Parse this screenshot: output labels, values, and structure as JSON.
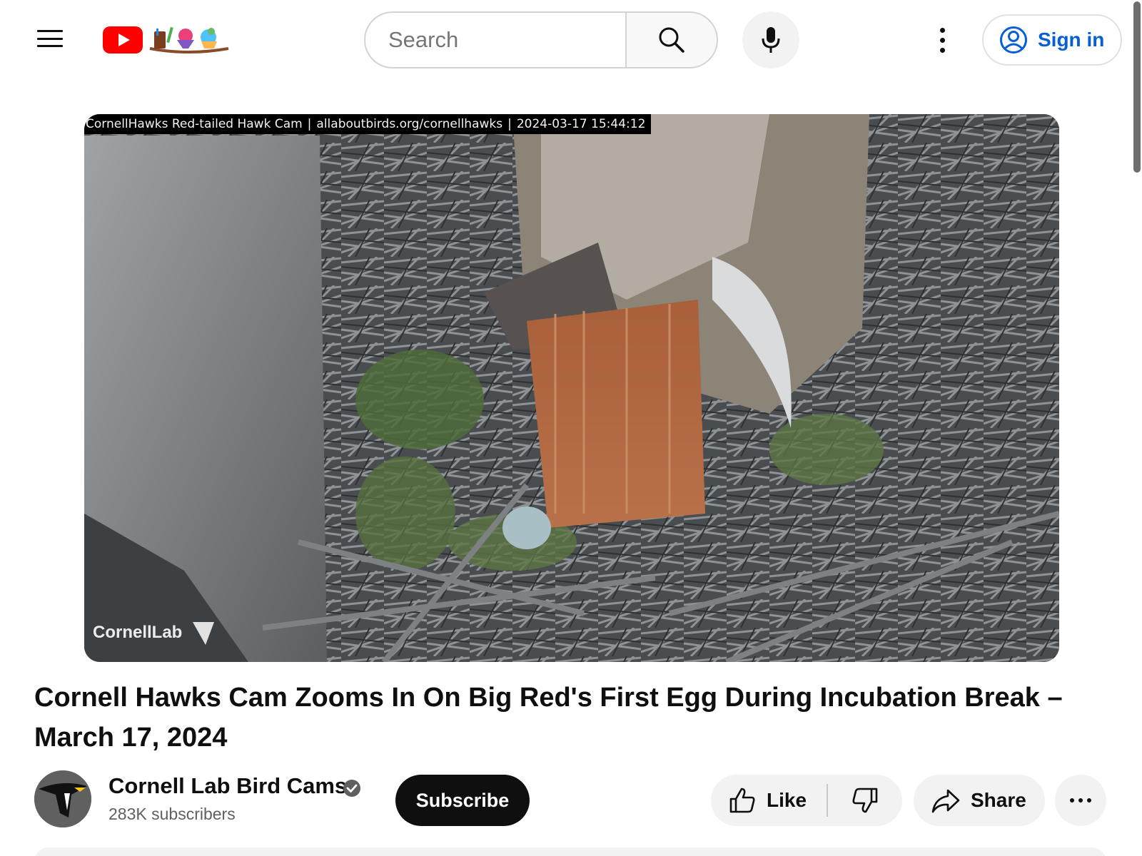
{
  "masthead": {
    "menu_icon": "hamburger-menu-icon",
    "logo_icon": "youtube-doodle-logo",
    "search": {
      "placeholder": "Search",
      "value": "",
      "button_icon": "search-icon"
    },
    "voice_search_icon": "microphone-icon",
    "settings_icon": "vertical-dots-icon",
    "sign_in": {
      "label": "Sign in",
      "icon": "account-circle-icon"
    },
    "colors": {
      "brand_red": "#ff0000",
      "sign_in_blue": "#065fd4"
    }
  },
  "player": {
    "overlay_parts": [
      "CornellHawks Red-tailed Hawk Cam",
      "allaboutbirds.org/cornellhawks",
      "2024-03-17 15:44:12"
    ],
    "overlay_separator": "|",
    "watermark": "CornellLab"
  },
  "video": {
    "title": "Cornell Hawks Cam Zooms In On Big Red's First Egg During Incubation Break – March 17, 2024"
  },
  "owner": {
    "channel_name": "Cornell Lab Bird Cams",
    "verified_icon": "verified-check-icon",
    "subscribers": "283K subscribers",
    "subscribe_label": "Subscribe"
  },
  "actions": {
    "like_label": "Like",
    "like_icon": "thumb-up-icon",
    "dislike_icon": "thumb-down-icon",
    "share_label": "Share",
    "share_icon": "share-arrow-icon",
    "more_icon": "horizontal-dots-icon"
  }
}
